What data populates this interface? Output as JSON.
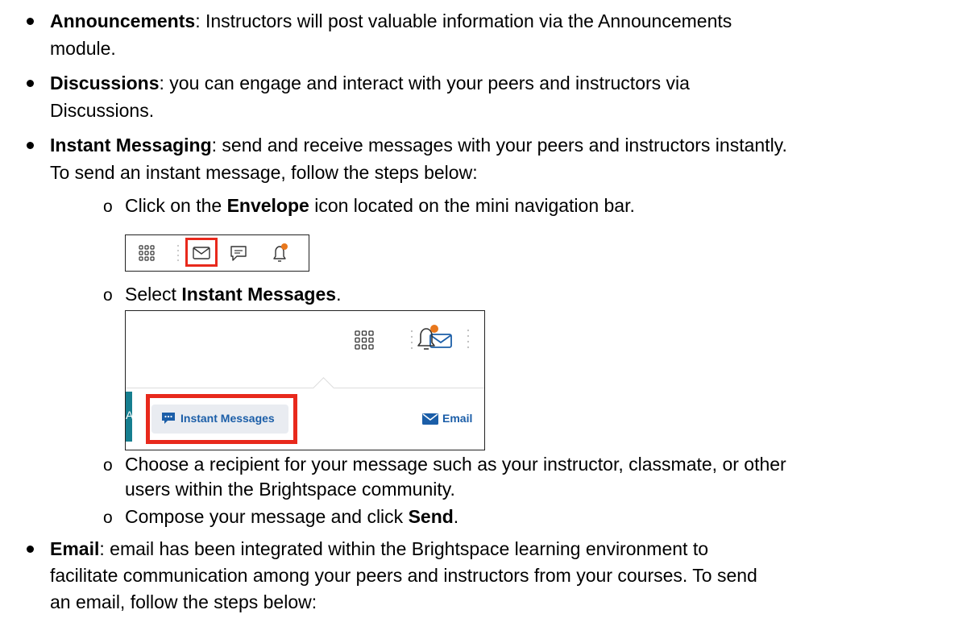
{
  "items": {
    "announcements": {
      "term": "Announcements",
      "line1": ": Instructors will post valuable information via the Announcements",
      "line2": "module."
    },
    "discussions": {
      "term": "Discussions",
      "line1": ": you can engage and interact with your peers and instructors via",
      "line2": "Discussions."
    },
    "instant_messaging": {
      "term": "Instant Messaging",
      "line1": ": send and receive messages with your peers and instructors instantly.",
      "line2": "To send an instant message, follow the steps below:",
      "steps": {
        "s1_pre": "Click on the ",
        "s1_bold": "Envelope",
        "s1_post": " icon located on the mini navigation bar.",
        "s2_pre": "Select ",
        "s2_bold": "Instant Messages",
        "s2_post": ".",
        "s3_line1": "Choose a recipient for your message such as your instructor, classmate, or other",
        "s3_line2": "users within the Brightspace community.",
        "s4_pre": "Compose your message and click ",
        "s4_bold": "Send",
        "s4_post": "."
      }
    },
    "email": {
      "term": "Email",
      "line1": ": email has been integrated within the Brightspace learning environment to",
      "line2": "facilitate communication among your peers and instructors from your courses. To send",
      "line3": "an email, follow the steps below:"
    }
  },
  "screenshot2": {
    "instant_messages_label": "Instant Messages",
    "email_label": "Email",
    "ghost_letter": "A"
  },
  "colors": {
    "highlight": "#e8291c",
    "link_blue": "#1b5ea8",
    "notification_dot": "#e8771c",
    "teal": "#167e8f"
  }
}
